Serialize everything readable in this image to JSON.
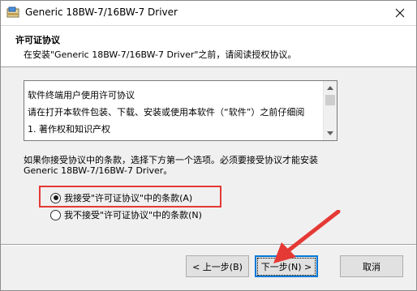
{
  "window": {
    "title": "Generic 18BW-7/16BW-7 Driver"
  },
  "header": {
    "title": "许可证协议",
    "subtitle": "在安装\"Generic 18BW-7/16BW-7 Driver\"之前，请阅读授权协议。"
  },
  "license": {
    "lines": [
      "软件终端用户使用许可协议",
      "请在打开本软件包装、下载、安装或使用本软件（“软件”）之前仔细阅",
      "1. 著作权和知识产权"
    ]
  },
  "prompt": "如果你接受协议中的条款，选择下方第一个选项。必须要接受协议才能安装 Generic 18BW-7/16BW-7 Driver。",
  "options": [
    {
      "label": "我接受\"许可证协议\"中的条款(A)",
      "selected": true
    },
    {
      "label": "我不接受\"许可证协议\"中的条款(N)",
      "selected": false
    }
  ],
  "buttons": {
    "back": "< 上一步(B)",
    "next": "下一步(N) >",
    "cancel": "取消"
  },
  "annotation_color": "#e53935",
  "icons": {
    "close": "close-icon",
    "app": "installer-icon"
  }
}
